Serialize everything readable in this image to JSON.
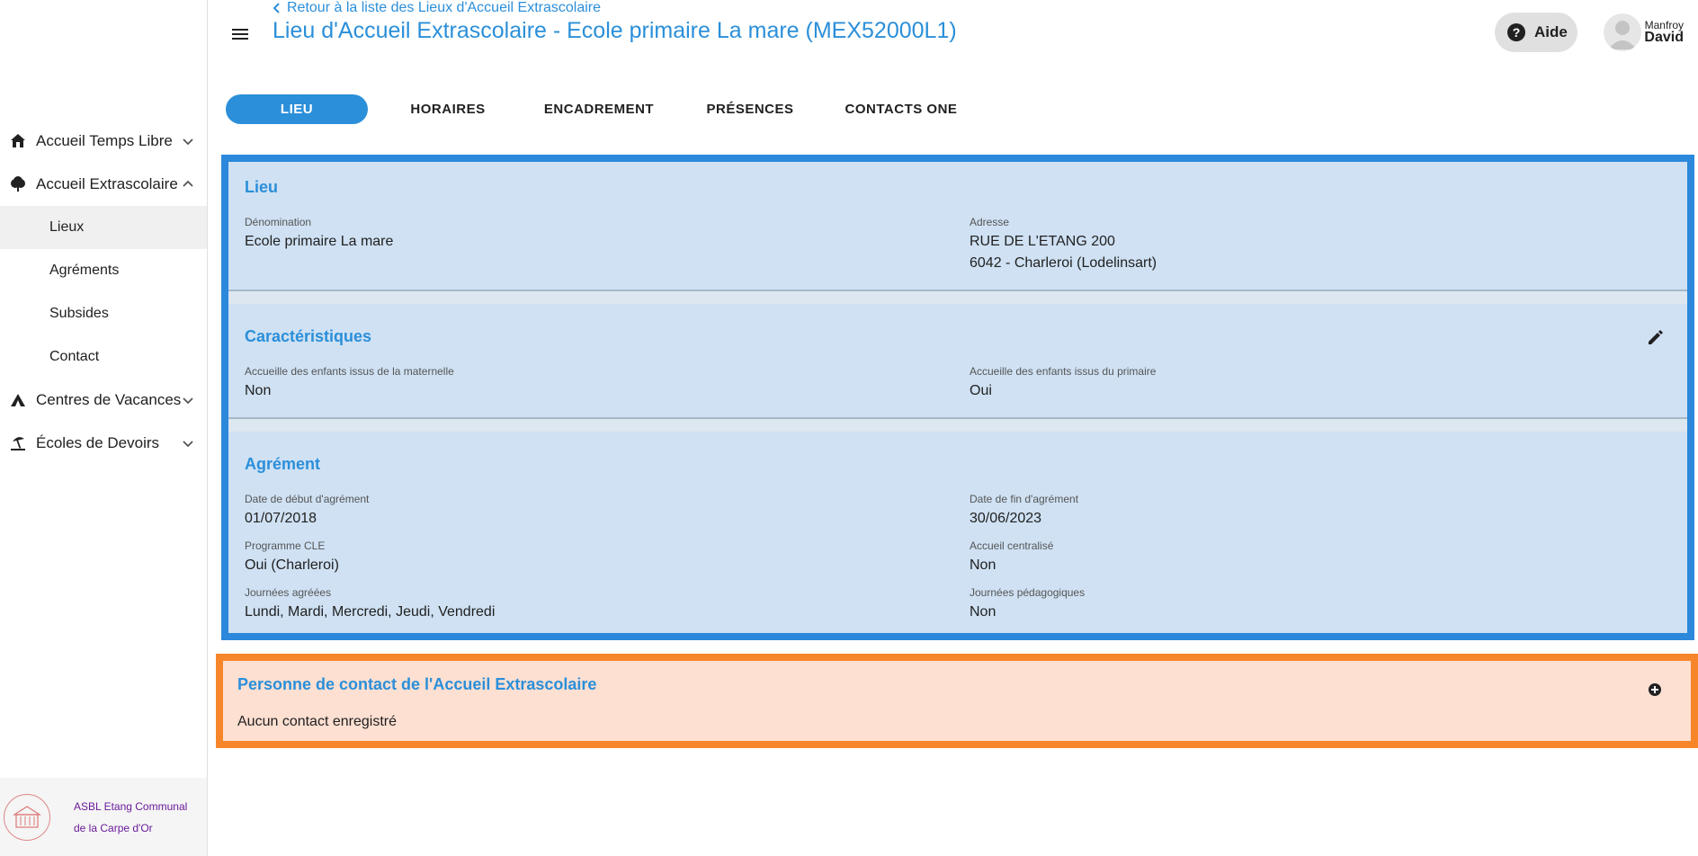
{
  "header": {
    "back_link": "Retour à la liste des Lieux d'Accueil Extrascolaire",
    "title": "Lieu d'Accueil Extrascolaire - Ecole primaire La mare (MEX52000L1)",
    "help_label": "Aide",
    "user_first": "Manfroy",
    "user_last": "David"
  },
  "sidebar": {
    "items": [
      {
        "label": "Accueil Temps Libre",
        "icon": "house-icon",
        "expanded": false
      },
      {
        "label": "Accueil Extrascolaire",
        "icon": "tree-icon",
        "expanded": true
      },
      {
        "label": "Centres de Vacances",
        "icon": "tent-icon",
        "expanded": false
      },
      {
        "label": "Écoles de Devoirs",
        "icon": "beach-icon",
        "expanded": false
      }
    ],
    "subitems": [
      "Lieux",
      "Agréments",
      "Subsides",
      "Contact"
    ],
    "org_name": "ASBL Etang Communal de la Carpe d'Or"
  },
  "tabs": [
    "LIEU",
    "HORAIRES",
    "ENCADREMENT",
    "PRÉSENCES",
    "CONTACTS ONE"
  ],
  "lieu": {
    "title": "Lieu",
    "denomination_label": "Dénomination",
    "denomination_value": "Ecole primaire La mare",
    "adresse_label": "Adresse",
    "adresse_line1": "RUE DE L'ETANG 200",
    "adresse_line2": "6042 - Charleroi (Lodelinsart)"
  },
  "caracteristiques": {
    "title": "Caractéristiques",
    "maternelle_label": "Accueille des enfants issus de la maternelle",
    "maternelle_value": "Non",
    "primaire_label": "Accueille des enfants issus du primaire",
    "primaire_value": "Oui"
  },
  "agrement": {
    "title": "Agrément",
    "debut_label": "Date de début d'agrément",
    "debut_value": "01/07/2018",
    "fin_label": "Date de fin d'agrément",
    "fin_value": "30/06/2023",
    "cle_label": "Programme CLE",
    "cle_value": "Oui (Charleroi)",
    "centralise_label": "Accueil centralisé",
    "centralise_value": "Non",
    "journees_label": "Journées agréées",
    "journees_value": "Lundi, Mardi, Mercredi, Jeudi, Vendredi",
    "pedago_label": "Journées pédagogiques",
    "pedago_value": "Non"
  },
  "contact": {
    "title": "Personne de contact de l'Accueil Extrascolaire",
    "empty": "Aucun contact enregistré"
  },
  "colors": {
    "accent": "#2b8fd9",
    "section_bg": "#cfe1f3",
    "highlight_blue": "#2b88db",
    "highlight_orange": "#f7862b",
    "contact_bg": "#fde0d2"
  }
}
